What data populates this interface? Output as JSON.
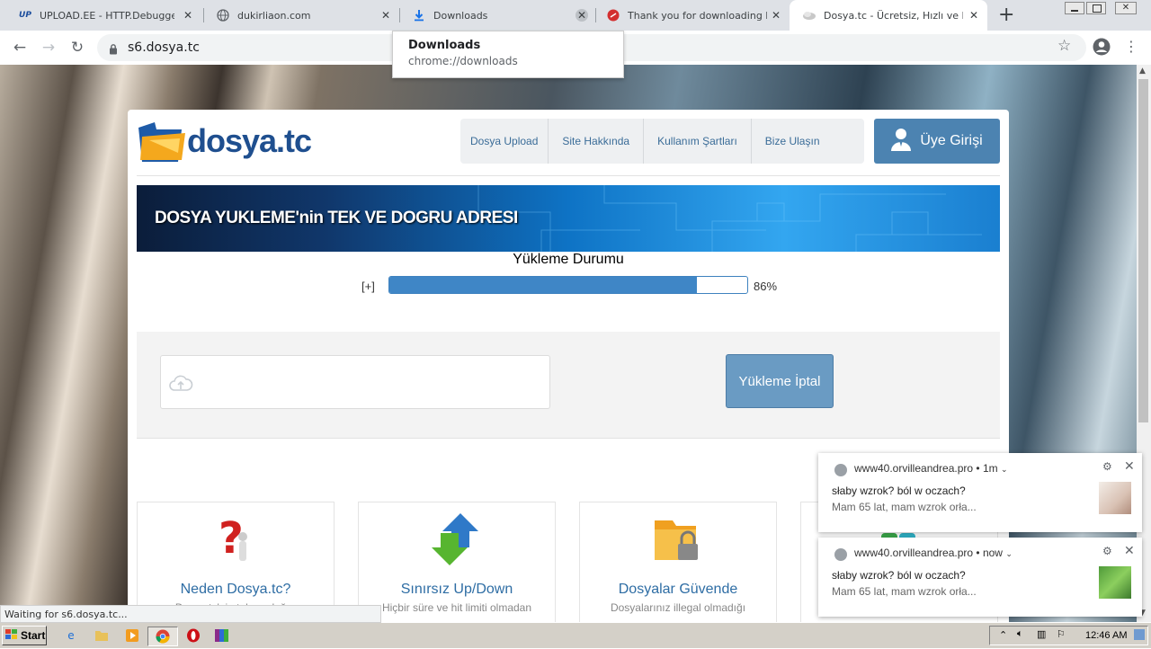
{
  "browser": {
    "tabs": [
      {
        "title": "UPLOAD.EE - HTTP.Debugger.Pr",
        "favicon": "upload-ee-icon"
      },
      {
        "title": "dukirliaon.com",
        "favicon": "globe-icon"
      },
      {
        "title": "Downloads",
        "favicon": "download-icon"
      },
      {
        "title": "Thank you for downloading HTT",
        "favicon": "red-circle-icon"
      },
      {
        "title": "Dosya.tc - Ücretsiz, Hızlı ve Kola",
        "favicon": "dosya-icon",
        "active": true
      }
    ],
    "new_tab": "+",
    "url": "s6.dosya.tc",
    "tooltip": {
      "title": "Downloads",
      "url": "chrome://downloads"
    }
  },
  "site": {
    "logo": "dosya.tc",
    "nav": [
      "Dosya Upload",
      "Site Hakkında",
      "Kullanım Şartları",
      "Bize Ulaşın"
    ],
    "login": "Üye Girişi",
    "banner_text": "DOSYA YUKLEME'nin TEK VE DOGRU ADRESI",
    "upload_status_title": "Yükleme Durumu",
    "expand": "[+]",
    "progress_percent": 86,
    "progress_label": "86%",
    "cancel_button": "Yükleme İptal",
    "features": [
      {
        "title": "Neden Dosya.tc?",
        "desc": "Dosya.tc'nin tek ve doğru",
        "icon": "question-mark-icon"
      },
      {
        "title": "Sınırsız Up/Down",
        "desc": "Hiçbir süre ve hit limiti olmadan",
        "icon": "up-down-arrows-icon"
      },
      {
        "title": "Dosyalar Güvende",
        "desc": "Dosyalarınız illegal olmadığı",
        "icon": "locked-folder-icon"
      }
    ]
  },
  "notifications": [
    {
      "site": "www40.orvilleandrea.pro",
      "time": "1m",
      "title": "słaby wzrok? ból w oczach?",
      "body": "Mam 65 lat, mam wzrok orła..."
    },
    {
      "site": "www40.orvilleandrea.pro",
      "time": "now",
      "title": "słaby wzrok? ból w oczach?",
      "body": "Mam 65 lat, mam wzrok orła..."
    }
  ],
  "status_bar": "Waiting for s6.dosya.tc...",
  "taskbar": {
    "start": "Start",
    "clock": "12:46 AM"
  }
}
